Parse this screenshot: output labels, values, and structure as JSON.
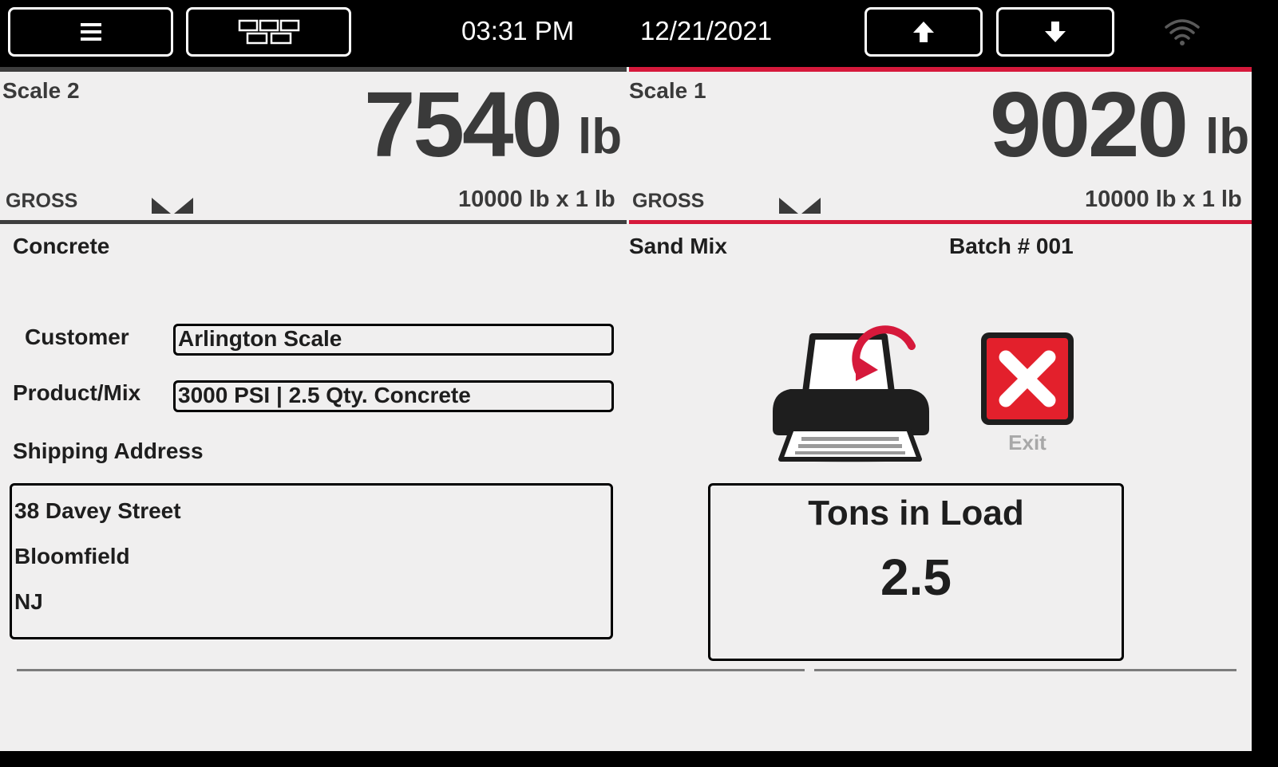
{
  "topbar": {
    "time": "03:31 PM",
    "date": "12/21/2021",
    "menu_icon": "hamburger-menu-icon",
    "layout_icon": "grid-layout-icon",
    "up_icon": "arrow-up-icon",
    "down_icon": "arrow-down-icon",
    "wifi_icon": "wifi-icon"
  },
  "scales": {
    "scale2": {
      "name": "Scale 2",
      "weight": "7540",
      "unit": "lb",
      "mode": "GROSS",
      "capacity": "10000 lb x 1 lb",
      "accent": "#3e3e3e"
    },
    "scale1": {
      "name": "Scale 1",
      "weight": "9020",
      "unit": "lb",
      "mode": "GROSS",
      "capacity": "10000 lb x 1 lb",
      "accent": "#d6193b"
    }
  },
  "material_left": "Concrete",
  "material_right": "Sand Mix",
  "batch": "Batch # 001",
  "form": {
    "customer_label": "Customer",
    "customer_value": "Arlington Scale",
    "product_label": "Product/Mix",
    "product_value": "3000 PSI | 2.5 Qty. Concrete",
    "shipping_label": "Shipping Address",
    "address": [
      "38 Davey Street",
      "Bloomfield",
      "NJ"
    ]
  },
  "actions": {
    "print_icon": "reprint-icon",
    "exit_icon": "exit-close-icon",
    "exit_label": "Exit",
    "exit_color": "#e3202c"
  },
  "tons": {
    "title": "Tons in Load",
    "value": "2.5"
  }
}
